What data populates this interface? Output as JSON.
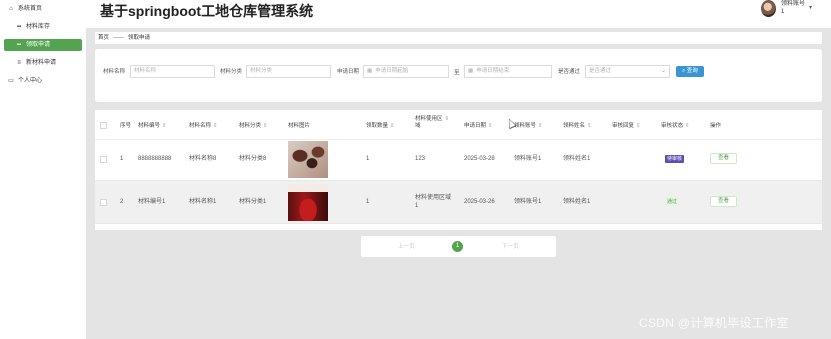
{
  "app": {
    "title": "基于springboot工地仓库管理系统"
  },
  "user": {
    "name_line1": "领料账号",
    "name_line2": "1"
  },
  "sidebar": {
    "items": [
      {
        "label": "系统首页",
        "icon": "home-icon"
      },
      {
        "label": "材料库存",
        "icon": "grid-icon"
      },
      {
        "label": "领取申请",
        "icon": "grid-icon",
        "active": true
      },
      {
        "label": "新材料申请",
        "icon": "list-icon"
      },
      {
        "label": "个人中心",
        "icon": "user-card-icon"
      }
    ]
  },
  "breadcrumb": {
    "home": "首页",
    "separator": "——",
    "current": "领取申请"
  },
  "search": {
    "material_name_label": "材料名称",
    "material_name_placeholder": "材料名称",
    "material_category_label": "材料分类",
    "material_category_placeholder": "材料分类",
    "apply_date_label": "申请日期",
    "date_start_placeholder": "申请日期起始",
    "date_to": "至",
    "date_end_placeholder": "申请日期结束",
    "approved_label": "是否通过",
    "approved_placeholder": "是否通过",
    "search_button": "查询"
  },
  "table": {
    "headers": {
      "index": "序号",
      "code": "材料编号",
      "name": "材料名称",
      "category": "材料分类",
      "image": "材料图片",
      "qty": "领取数量",
      "area_l1": "材料使用区",
      "area_l2": "域",
      "date": "申请日期",
      "account": "领料账号",
      "realname": "领料姓名",
      "reply": "审核回复",
      "status": "审核状态",
      "action": "操作"
    },
    "rows": [
      {
        "index": "1",
        "code": "8888888888",
        "name": "材料名称8",
        "category": "材料分类8",
        "qty": "1",
        "area_l1": "123",
        "area_l2": "",
        "date": "2025-03-28",
        "account": "领料账号1",
        "realname": "领料姓名1",
        "reply": "",
        "status": "待审核",
        "action": "查看"
      },
      {
        "index": "2",
        "code": "材料编号1",
        "name": "材料名称1",
        "category": "材料分类1",
        "qty": "1",
        "area_l1": "材料使用区域",
        "area_l2": "1",
        "date": "2025-03-26",
        "account": "领料账号1",
        "realname": "领料姓名1",
        "reply": "",
        "status": "通过",
        "action": "查看"
      }
    ]
  },
  "pagination": {
    "prev": "上一页",
    "current": "1",
    "next": "下一页"
  },
  "watermark": "CSDN @计算机毕设工作室",
  "colors": {
    "accent": "#53a350",
    "search_button": "#3c95d3",
    "pending_badge": "#5c4eb3"
  }
}
